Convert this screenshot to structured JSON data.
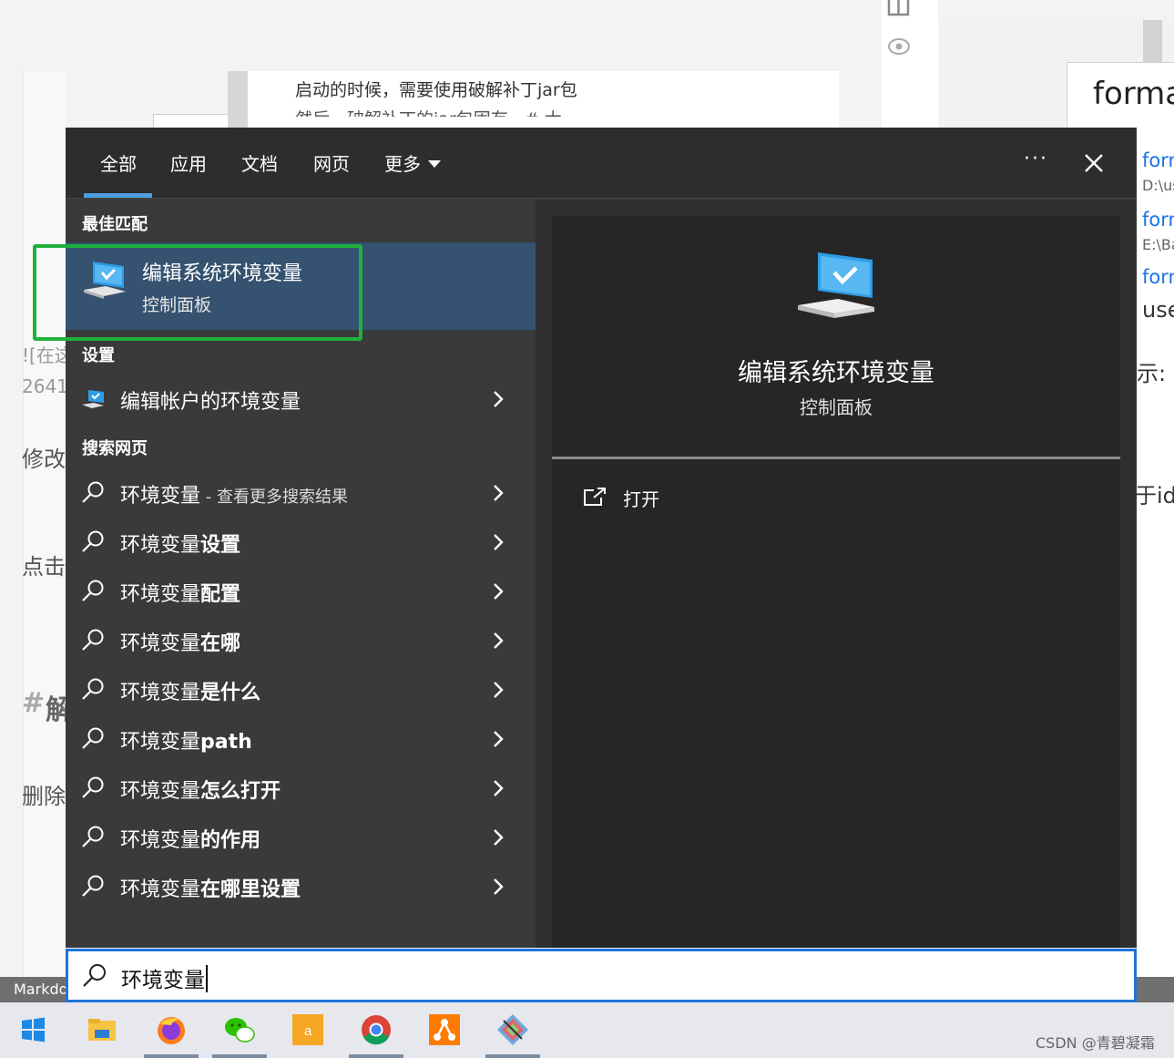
{
  "background": {
    "doc_line1": "启动的时候，需要使用破解补丁jar包",
    "doc_line2": "然后，破解补丁的jar包固有...#.大",
    "fragments": {
      "img_alt": "![在这",
      "num": "2641",
      "modify": "修改",
      "click": "点击",
      "hash": "#",
      "heading": "解",
      "delete": "删除"
    },
    "right_box_text": "forma",
    "right_side": {
      "link1": "forn",
      "path1": "D:\\us",
      "link2": "forn",
      "path2": "E:\\Ba",
      "link3": "forn",
      "use": "use",
      "shi": "示:",
      "yuid": "于id"
    },
    "status_bar_label": "Markdo"
  },
  "search": {
    "tabs": [
      {
        "label": "全部",
        "active": true
      },
      {
        "label": "应用"
      },
      {
        "label": "文档"
      },
      {
        "label": "网页"
      },
      {
        "label": "更多"
      }
    ],
    "more_dots": "···",
    "sections": {
      "best_match": "最佳匹配",
      "settings": "设置",
      "web": "搜索网页"
    },
    "best_match": {
      "title": "编辑系统环境变量",
      "subtitle": "控制面板",
      "icon": "monitor-check-icon"
    },
    "settings_item": {
      "label": "编辑帐户的环境变量",
      "icon": "monitor-settings-icon"
    },
    "web_results": [
      {
        "prefix": "环境变量",
        "suffix": "",
        "hint": " - 查看更多搜索结果"
      },
      {
        "prefix": "环境变量",
        "suffix": "设置",
        "hint": ""
      },
      {
        "prefix": "环境变量",
        "suffix": "配置",
        "hint": ""
      },
      {
        "prefix": "环境变量",
        "suffix": "在哪",
        "hint": ""
      },
      {
        "prefix": "环境变量",
        "suffix": "是什么",
        "hint": ""
      },
      {
        "prefix": "环境变量",
        "suffix": "path",
        "hint": ""
      },
      {
        "prefix": "环境变量",
        "suffix": "怎么打开",
        "hint": ""
      },
      {
        "prefix": "环境变量",
        "suffix": "的作用",
        "hint": ""
      },
      {
        "prefix": "环境变量",
        "suffix": "在哪里设置",
        "hint": ""
      }
    ],
    "detail": {
      "title": "编辑系统环境变量",
      "subtitle": "控制面板",
      "open_label": "打开"
    },
    "query": "环境变量"
  },
  "taskbar": {
    "items": [
      "windows-start-icon",
      "file-explorer-icon",
      "firefox-icon",
      "wechat-icon",
      "orange-app-icon",
      "chrome-icon",
      "sourcetree-icon",
      "git-gui-icon"
    ]
  },
  "watermark": "CSDN @青碧凝霜",
  "colors": {
    "accent": "#4c9fe3",
    "best_match_bg": "#355270",
    "highlight": "#1fb13b",
    "search_border": "#1f73d8"
  }
}
